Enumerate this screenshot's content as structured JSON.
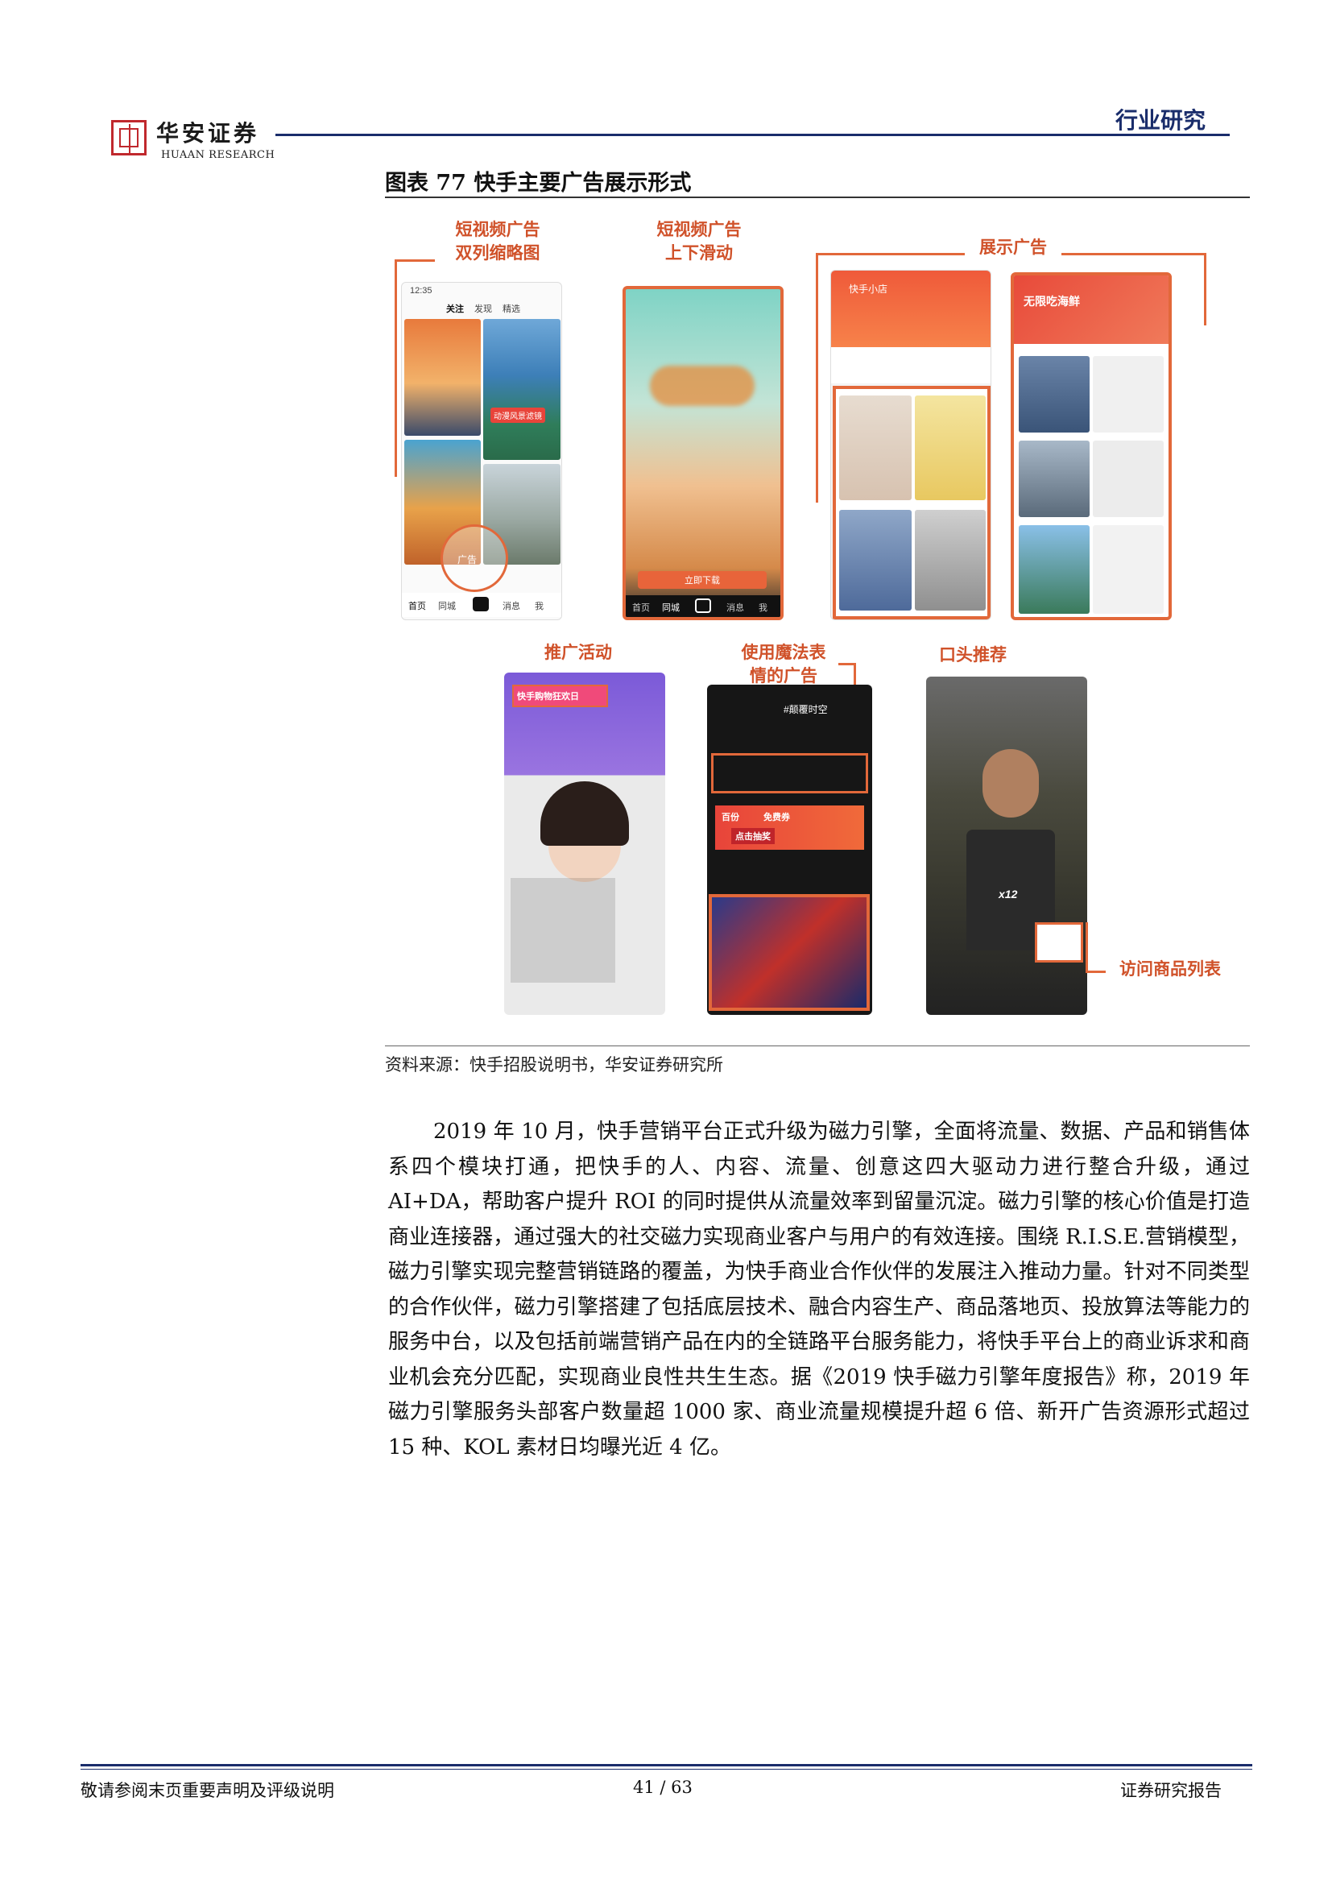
{
  "header": {
    "logo_cn": "华安证券",
    "logo_en": "HUAAN RESEARCH",
    "section": "行业研究"
  },
  "figure": {
    "title": "图表 77 快手主要广告展示形式",
    "callouts": {
      "short_video_double_line1": "短视频广告",
      "short_video_double_line2": "双列缩略图",
      "short_video_scroll_line1": "短视频广告",
      "short_video_scroll_line2": "上下滑动",
      "display": "展示广告",
      "promotion": "推广活动",
      "magic_line1": "使用魔法表",
      "magic_line2": "情的广告",
      "verbal": "口头推荐",
      "product_list": "访问商品列表"
    },
    "screen_text": {
      "phone1_time": "12:35",
      "phone1_tabs": [
        "关注",
        "发现",
        "精选"
      ],
      "phone1_tag": "动漫风景滤镜",
      "phone1_ad": "广告",
      "phone1_nav": [
        "首页",
        "同城",
        "消息",
        "我"
      ],
      "phone2_nav": [
        "首页",
        "同城",
        "消息",
        "我"
      ],
      "phone2_button": "立即下载",
      "phone3_title": "快手小店",
      "phone4_banner": "无限吃海鲜",
      "phone5_banner": "快手购物狂欢日",
      "phone6_tag": "#颠覆时空",
      "phone6_promo1": "百份",
      "phone6_promo2": "免费券",
      "phone6_button": "点击抽奖",
      "phone7_badge": "x12"
    },
    "source": "资料来源：快手招股说明书，华安证券研究所"
  },
  "body": {
    "paragraph": "2019 年 10 月，快手营销平台正式升级为磁力引擎，全面将流量、数据、产品和销售体系四个模块打通，把快手的人、内容、流量、创意这四大驱动力进行整合升级，通过 AI+DA，帮助客户提升 ROI 的同时提供从流量效率到留量沉淀。磁力引擎的核心价值是打造商业连接器，通过强大的社交磁力实现商业客户与用户的有效连接。围绕 R.I.S.E.营销模型，磁力引擎实现完整营销链路的覆盖，为快手商业合作伙伴的发展注入推动力量。针对不同类型的合作伙伴，磁力引擎搭建了包括底层技术、融合内容生产、商品落地页、投放算法等能力的服务中台，以及包括前端营销产品在内的全链路平台服务能力，将快手平台上的商业诉求和商业机会充分匹配，实现商业良性共生生态。据《2019 快手磁力引擎年度报告》称，2019 年磁力引擎服务头部客户数量超 1000 家、商业流量规模提升超 6 倍、新开广告资源形式超过 15 种、KOL 素材日均曝光近 4 亿。"
  },
  "footer": {
    "disclaimer": "敬请参阅末页重要声明及评级说明",
    "page": "41 / 63",
    "report_type": "证券研究报告"
  },
  "colors": {
    "navy": "#1a2d6b",
    "accent_orange": "#e2683a",
    "callout_text": "#d0522a",
    "logo_red": "#c0282d"
  }
}
